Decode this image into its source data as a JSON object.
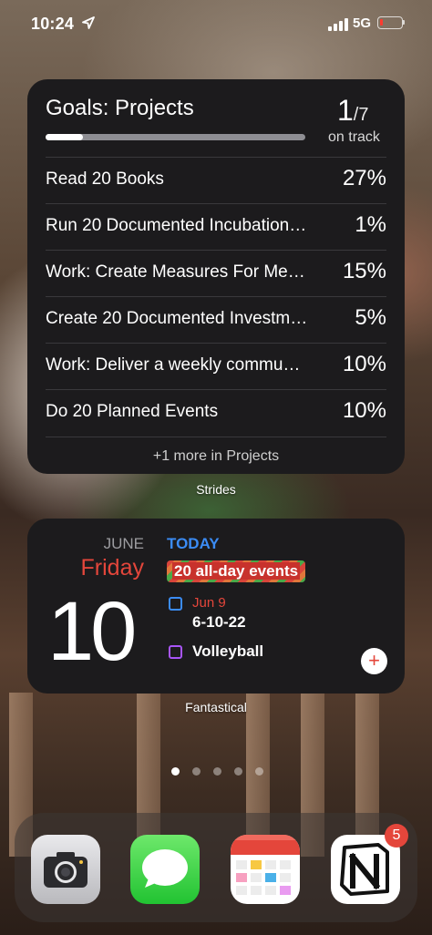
{
  "status_bar": {
    "time": "10:24",
    "network": "5G"
  },
  "strides": {
    "title": "Goals: Projects",
    "count_num": "1",
    "count_den": "/7",
    "count_label": "on track",
    "progress_fraction": 0.143,
    "goals": [
      {
        "name": "Read 20 Books",
        "percent": "27%"
      },
      {
        "name": "Run 20 Documented Incubation…",
        "percent": "1%"
      },
      {
        "name": "Work: Create Measures For Me…",
        "percent": "15%"
      },
      {
        "name": "Create 20 Documented Investm…",
        "percent": "5%"
      },
      {
        "name": "Work: Deliver a weekly commu…",
        "percent": "10%"
      },
      {
        "name": "Do 20 Planned Events",
        "percent": "10%"
      }
    ],
    "more": "+1 more in Projects",
    "widget_label": "Strides"
  },
  "fantastical": {
    "month": "JUNE",
    "weekday": "Friday",
    "date": "10",
    "today_label": "TODAY",
    "allday": "20 all-day events",
    "events": [
      {
        "date": "Jun 9",
        "title": "6-10-22",
        "color": "#3b8cf5"
      },
      {
        "title": "Volleyball",
        "color": "#a855f7"
      }
    ],
    "add_symbol": "+",
    "widget_label": "Fantastical"
  },
  "page_dots": {
    "count": 5,
    "active": 0
  },
  "dock": {
    "apps": [
      {
        "name": "Camera",
        "icon": "camera-icon"
      },
      {
        "name": "Messages",
        "icon": "messages-icon"
      },
      {
        "name": "Fantastical",
        "icon": "fantastical-icon"
      },
      {
        "name": "Notion",
        "icon": "notion-icon"
      }
    ],
    "notion_badge": "5"
  }
}
